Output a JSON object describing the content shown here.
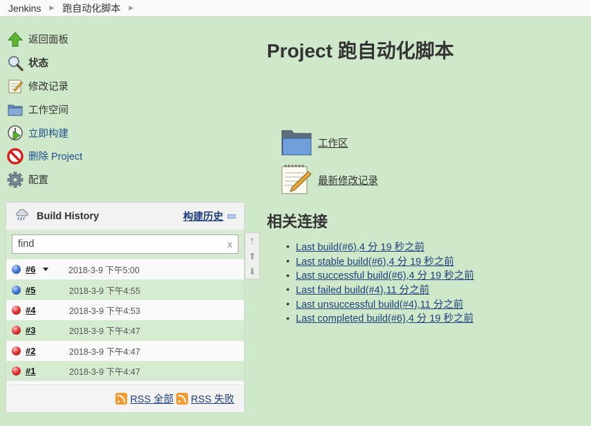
{
  "breadcrumb": {
    "items": [
      "Jenkins",
      "跑自动化脚本"
    ]
  },
  "tasks": [
    {
      "label": "返回面板",
      "icon": "up-arrow-icon",
      "link": false,
      "bold": false
    },
    {
      "label": "状态",
      "icon": "search-icon",
      "link": false,
      "bold": true
    },
    {
      "label": "修改记录",
      "icon": "notepad-icon",
      "link": false,
      "bold": false
    },
    {
      "label": "工作空间",
      "icon": "folder-icon",
      "link": false,
      "bold": false
    },
    {
      "label": "立即构建",
      "icon": "clock-play-icon",
      "link": true,
      "bold": false
    },
    {
      "label": "删除 Project",
      "icon": "no-entry-icon",
      "link": true,
      "bold": false
    },
    {
      "label": "配置",
      "icon": "gear-icon",
      "link": false,
      "bold": false
    }
  ],
  "build_history": {
    "title": "Build History",
    "trend_label": "构建历史",
    "search_placeholder": "find",
    "clear_label": "x",
    "builds": [
      {
        "number": "#6",
        "status": "blue",
        "date": "2018-3-9 下午5:00",
        "menu": true
      },
      {
        "number": "#5",
        "status": "blue",
        "date": "2018-3-9 下午4:55",
        "menu": false
      },
      {
        "number": "#4",
        "status": "red",
        "date": "2018-3-9 下午4:53",
        "menu": false
      },
      {
        "number": "#3",
        "status": "red",
        "date": "2018-3-9 下午4:47",
        "menu": false
      },
      {
        "number": "#2",
        "status": "red",
        "date": "2018-3-9 下午4:47",
        "menu": false
      },
      {
        "number": "#1",
        "status": "red",
        "date": "2018-3-9 下午4:47",
        "menu": false
      }
    ],
    "rss_all": "RSS 全部",
    "rss_failed": "RSS 失败"
  },
  "main": {
    "title": "Project 跑自动化脚本",
    "workspace_link": "工作区",
    "changes_link": "最新修改记录",
    "permalinks_title": "相关连接",
    "permalinks": [
      "Last build(#6),4 分 19 秒之前",
      "Last stable build(#6),4 分 19 秒之前",
      "Last successful build(#6),4 分 19 秒之前",
      "Last failed build(#4),11 分之前",
      "Last unsuccessful build(#4),11 分之前",
      "Last completed build(#6),4 分 19 秒之前"
    ]
  },
  "colors": {
    "background": "#cfe8c9",
    "link": "#1f3f7f",
    "success": "#4a7dd6",
    "failure": "#e43a3a"
  }
}
